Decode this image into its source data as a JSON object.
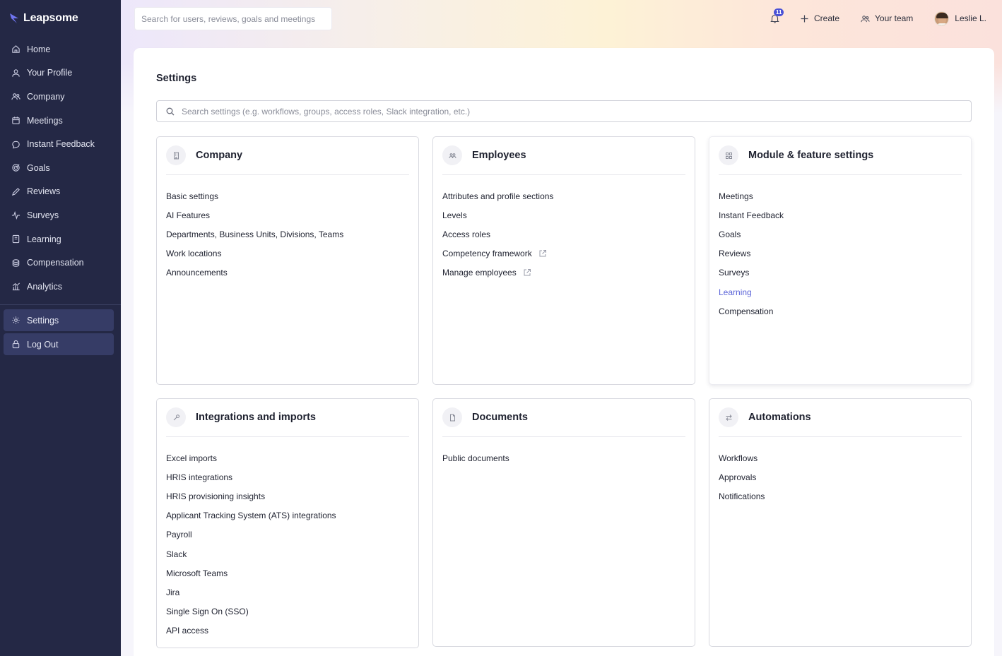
{
  "brand": {
    "name": "Leapsome"
  },
  "sidebar": {
    "items": [
      {
        "label": "Home",
        "icon": "home-icon"
      },
      {
        "label": "Your Profile",
        "icon": "user-icon"
      },
      {
        "label": "Company",
        "icon": "people-icon"
      },
      {
        "label": "Meetings",
        "icon": "calendar-icon"
      },
      {
        "label": "Instant Feedback",
        "icon": "chat-icon"
      },
      {
        "label": "Goals",
        "icon": "target-icon"
      },
      {
        "label": "Reviews",
        "icon": "pen-icon"
      },
      {
        "label": "Surveys",
        "icon": "pulse-icon"
      },
      {
        "label": "Learning",
        "icon": "book-icon"
      },
      {
        "label": "Compensation",
        "icon": "coins-icon"
      },
      {
        "label": "Analytics",
        "icon": "chart-icon"
      }
    ],
    "bottom": [
      {
        "label": "Settings",
        "icon": "gear-icon"
      },
      {
        "label": "Log Out",
        "icon": "lock-icon"
      }
    ]
  },
  "topbar": {
    "search_placeholder": "Search for users, reviews, goals and meetings",
    "notification_count": "11",
    "create_label": "Create",
    "team_label": "Your team",
    "user_name": "Leslie L."
  },
  "page": {
    "title": "Settings",
    "search_placeholder": "Search settings (e.g. workflows, groups, access roles, Slack integration, etc.)"
  },
  "cards": {
    "company": {
      "title": "Company",
      "links": [
        "Basic settings",
        "AI Features",
        "Departments, Business Units, Divisions, Teams",
        "Work locations",
        "Announcements"
      ]
    },
    "employees": {
      "title": "Employees",
      "links": [
        "Attributes and profile sections",
        "Levels",
        "Access roles",
        "Competency framework",
        "Manage employees"
      ]
    },
    "modules": {
      "title": "Module & feature settings",
      "links": [
        "Meetings",
        "Instant Feedback",
        "Goals",
        "Reviews",
        "Surveys",
        "Learning",
        "Compensation"
      ]
    },
    "integrations": {
      "title": "Integrations and imports",
      "links": [
        "Excel imports",
        "HRIS integrations",
        "HRIS provisioning insights",
        "Applicant Tracking System (ATS) integrations",
        "Payroll",
        "Slack",
        "Microsoft Teams",
        "Jira",
        "Single Sign On (SSO)",
        "API access"
      ]
    },
    "documents": {
      "title": "Documents",
      "links": [
        "Public documents"
      ]
    },
    "automations": {
      "title": "Automations",
      "links": [
        "Workflows",
        "Approvals",
        "Notifications"
      ]
    }
  },
  "colors": {
    "sidebar_bg": "#242845",
    "accent": "#5a63d8",
    "badge": "#4b52d6"
  }
}
